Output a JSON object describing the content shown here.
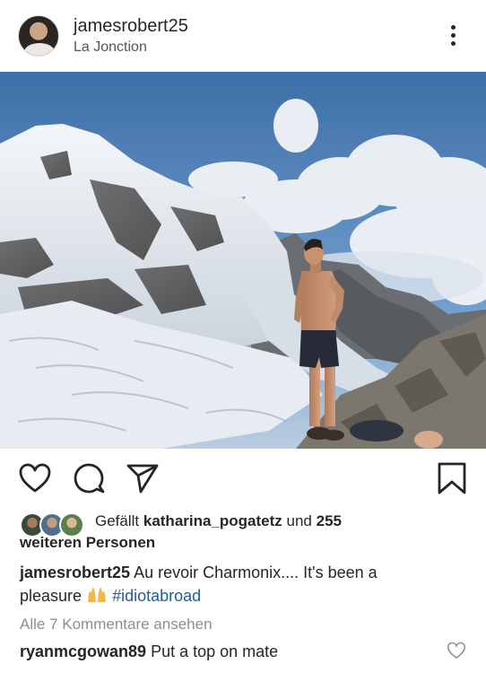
{
  "post": {
    "username": "jamesrobert25",
    "location": "La Jonction",
    "more_icon": "more-vertical-icon"
  },
  "actions": {
    "like_icon": "heart-icon",
    "comment_icon": "comment-icon",
    "share_icon": "send-icon",
    "save_icon": "bookmark-icon"
  },
  "likes": {
    "prefix": "Gefällt ",
    "user": "katharina_pogatetz",
    "middle": " und ",
    "count": "255",
    "suffix_line": "weiteren Personen"
  },
  "caption": {
    "username": "jamesrobert25",
    "text_part1": "Au revoir Charmonix.... It's been a",
    "text_part2": "pleasure",
    "emoji": "raising-hands-emoji",
    "hashtag": "#idiotabroad"
  },
  "comments": {
    "view_all": "Alle 7 Kommentare ansehen",
    "first": {
      "username": "ryanmcgowan89",
      "text": "Put a top on mate"
    }
  },
  "colors": {
    "hashtag": "#1f5d9a",
    "secondary_text": "#8e8e8e",
    "primary_text": "#262626"
  }
}
